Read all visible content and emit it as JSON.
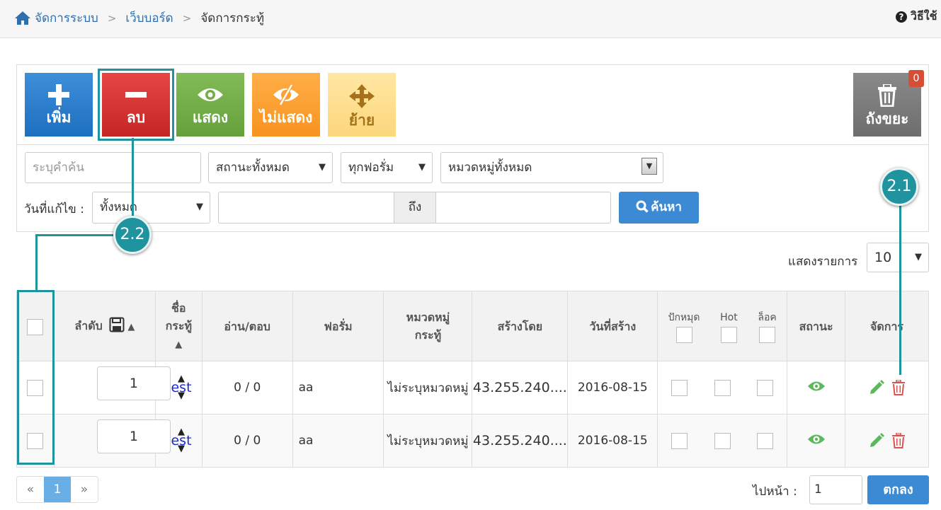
{
  "breadcrumb": {
    "home": "จัดการระบบ",
    "mid": "เว็บบอร์ด",
    "current": "จัดการกระทู้",
    "sep": ">"
  },
  "help": {
    "label": "วิธีใช้"
  },
  "toolbar": {
    "add": "เพิ่ม",
    "delete": "ลบ",
    "show": "แสดง",
    "hide": "ไม่แสดง",
    "move": "ย้าย",
    "trash": "ถังขยะ",
    "trash_count": "0"
  },
  "filters": {
    "search_placeholder": "ระบุคำค้น",
    "status": "สถานะทั้งหมด",
    "forum": "ทุกฟอรั่ม",
    "category": "หมวดหมู่ทั้งหมด",
    "date_label": "วันที่แก้ไข :",
    "date_range": "ทั้งหมด",
    "to": "ถึง",
    "search_button": "ค้นหา"
  },
  "list": {
    "show_label": "แสดงรายการ",
    "page_size": "10"
  },
  "table": {
    "headers": {
      "order": "ลำดับ",
      "name": "ชื่อกระทู้",
      "reads": "อ่าน/ตอบ",
      "forum": "ฟอรั่ม",
      "category": "หมวดหมู่กระทู้",
      "created_by": "สร้างโดย",
      "created_date": "วันที่สร้าง",
      "pin": "ปักหมุด",
      "hot": "Hot",
      "lock": "ล็อค",
      "status": "สถานะ",
      "manage": "จัดการ"
    },
    "rows": [
      {
        "order": "1",
        "name": "test",
        "reads": "0 / 0",
        "forum": "aa",
        "category": "ไม่ระบุหมวดหมู่",
        "created_by": "43.255.240....",
        "created_date": "2016-08-15"
      },
      {
        "order": "1",
        "name": "test",
        "reads": "0 / 0",
        "forum": "aa",
        "category": "ไม่ระบุหมวดหมู่",
        "created_by": "43.255.240....",
        "created_date": "2016-08-15"
      }
    ]
  },
  "pagination": {
    "prev": "«",
    "page": "1",
    "next": "»",
    "goto_label": "ไปหน้า :",
    "goto_value": "1",
    "ok": "ตกลง"
  },
  "callouts": {
    "c21": "2.1",
    "c22": "2.2"
  },
  "colors": {
    "callout": "#1f949e",
    "primary": "#3b8ad3",
    "danger": "#d9534f",
    "success": "#5cb85c"
  }
}
